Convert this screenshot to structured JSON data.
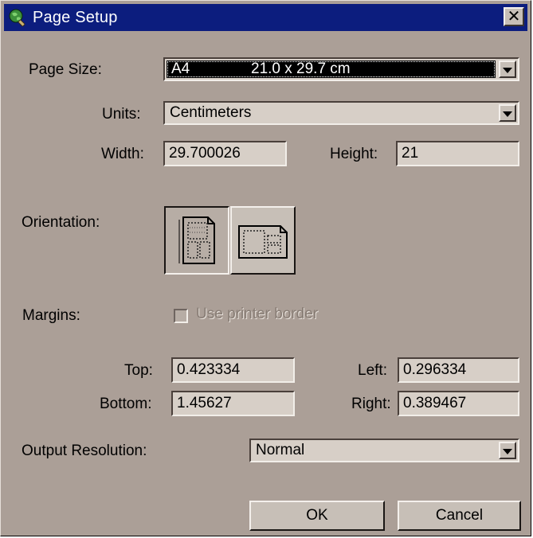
{
  "window": {
    "title": "Page Setup",
    "icon": "globe-magnifier-icon",
    "close_glyph": "✕"
  },
  "page_size": {
    "label": "Page Size:",
    "value_name": "A4",
    "value_dims": "21.0 x 29.7 cm"
  },
  "units": {
    "label": "Units:",
    "value": "Centimeters"
  },
  "dimensions": {
    "width_label": "Width:",
    "width_value": "29.700026",
    "height_label": "Height:",
    "height_value": "21"
  },
  "orientation": {
    "label": "Orientation:",
    "selected": "portrait"
  },
  "margins": {
    "label": "Margins:",
    "use_printer_border_label": "Use printer border",
    "use_printer_border_checked": false,
    "top_label": "Top:",
    "top_value": "0.423334",
    "left_label": "Left:",
    "left_value": "0.296334",
    "bottom_label": "Bottom:",
    "bottom_value": "1.45627",
    "right_label": "Right:",
    "right_value": "0.389467"
  },
  "output_resolution": {
    "label": "Output Resolution:",
    "value": "Normal"
  },
  "buttons": {
    "ok": "OK",
    "cancel": "Cancel"
  },
  "colors": {
    "dialog_bg": "#ab9f97",
    "titlebar_bg": "#0c1d7e",
    "field_bg": "#d7cfc7"
  }
}
